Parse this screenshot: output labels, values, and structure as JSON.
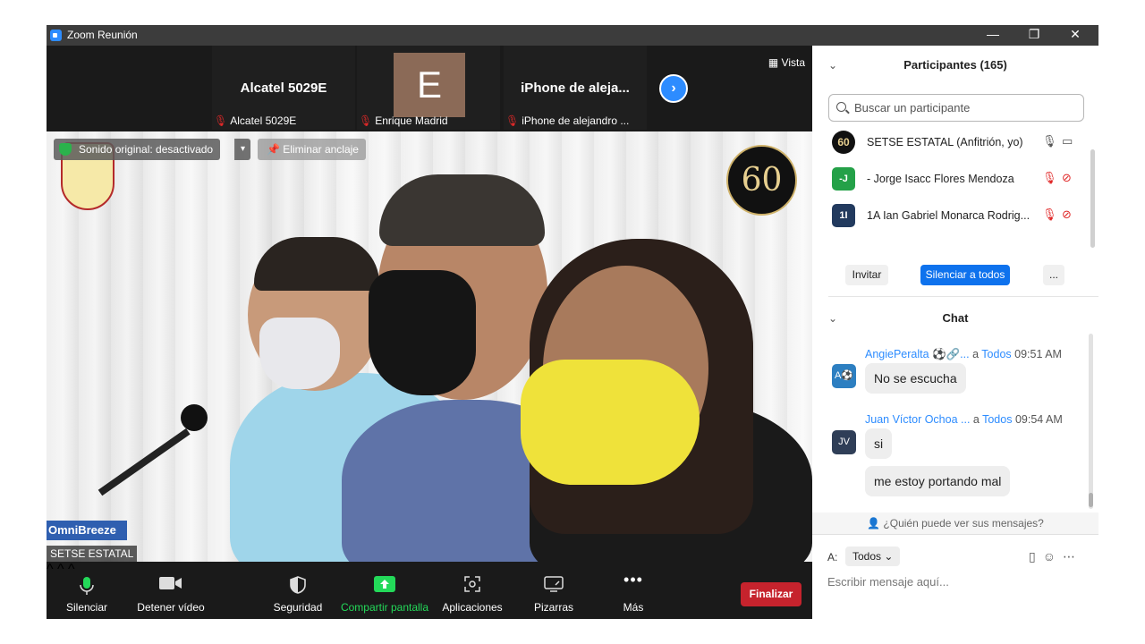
{
  "window": {
    "title": "Zoom Reunión",
    "buttons": [
      "—",
      "❐",
      "✕"
    ]
  },
  "thumbnails": [
    {
      "name": "Alcatel 5029E",
      "footer": "Alcatel 5029E"
    },
    {
      "avatar_letter": "E",
      "footer": "Enrique Madrid"
    },
    {
      "name": "iPhone de aleja...",
      "footer": "iPhone de alejandro ..."
    }
  ],
  "view_button": "Vista",
  "video": {
    "original_sound": "Sonido original: desactivado",
    "unpin": "Eliminar anclaje",
    "badge_text": "60",
    "banner_text": "OmniBreeze",
    "speaker_name": "SETSE ESTATAL"
  },
  "toolbar": {
    "mute": "Silenciar",
    "stop_video": "Detener vídeo",
    "security": "Seguridad",
    "share": "Compartir pantalla",
    "apps": "Aplicaciones",
    "whiteboards": "Pizarras",
    "more": "Más",
    "end": "Finalizar",
    "share_color": "#23d959",
    "end_color": "#c6232d"
  },
  "participants": {
    "header": "Participantes (165)",
    "search_placeholder": "Buscar un participante",
    "list": [
      {
        "avatar": "60",
        "name": "SETSE ESTATAL (Anfitrión, yo)",
        "avatar_color": "#111111",
        "mic": "on",
        "cam": "on"
      },
      {
        "avatar": "-J",
        "name": "- Jorge Isacc Flores Mendoza",
        "avatar_color": "#24a148",
        "mic": "off",
        "cam": "off"
      },
      {
        "avatar": "1I",
        "name": "1A Ian Gabriel Monarca Rodrig...",
        "avatar_color": "#223a5e",
        "mic": "off",
        "cam": "off"
      }
    ],
    "invite": "Invitar",
    "mute_all": "Silenciar a todos",
    "more": "..."
  },
  "chat": {
    "header": "Chat",
    "messages": [
      {
        "sender": "AngiePeralta ⚽🔗...",
        "to_word": "a",
        "to": "Todos",
        "time": "09:51 AM",
        "avatar": "A⚽",
        "avatar_color": "#2d7fc1",
        "texts": [
          "No se escucha"
        ]
      },
      {
        "sender": "Juan Víctor Ochoa ...",
        "to_word": "a",
        "to": "Todos",
        "time": "09:54 AM",
        "avatar": "JV",
        "avatar_color": "#2f3e57",
        "texts": [
          "si",
          "me estoy portando mal"
        ]
      }
    ],
    "who_can_see": "¿Quién puede ver sus mensajes?",
    "to_label": "A:",
    "recipient": "Todos",
    "placeholder": "Escribir mensaje aquí..."
  }
}
